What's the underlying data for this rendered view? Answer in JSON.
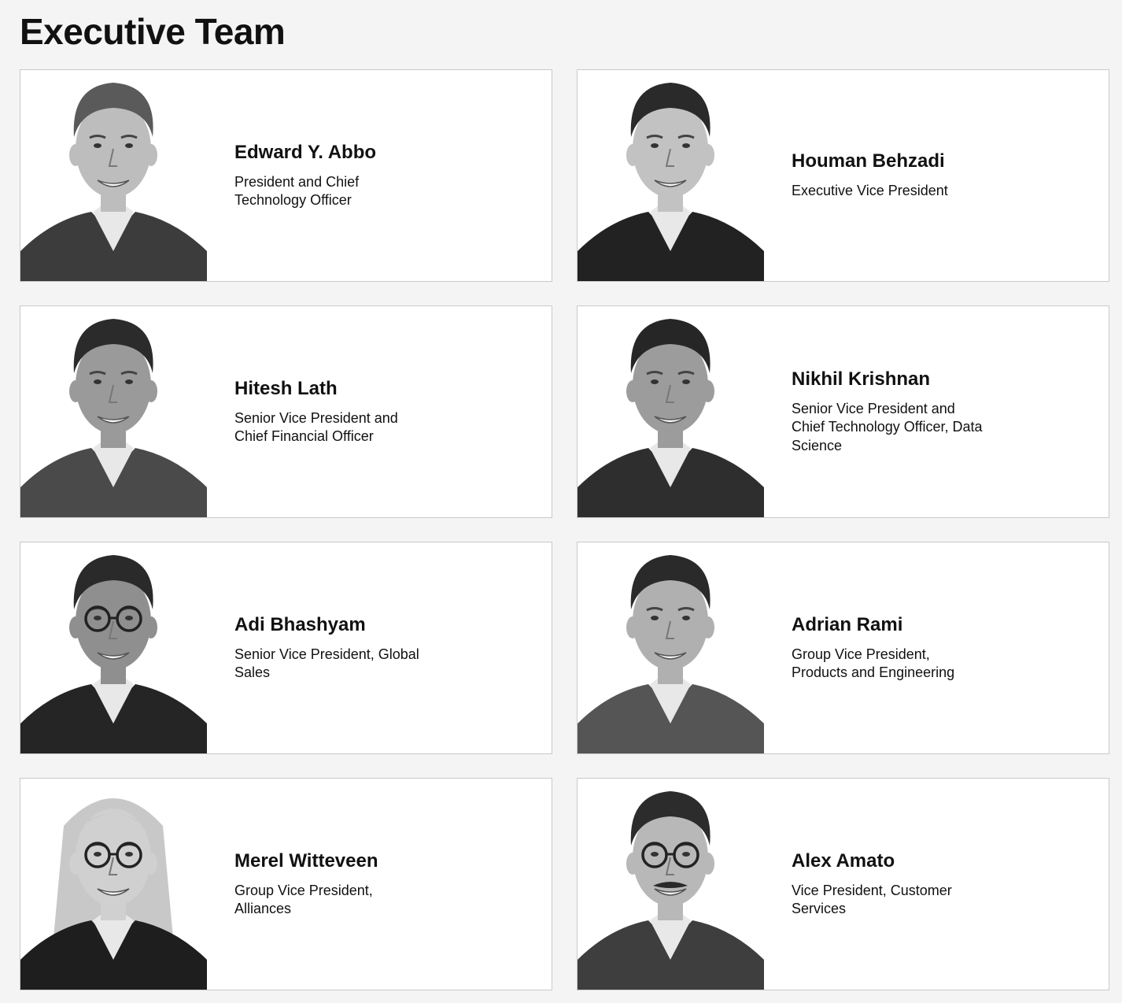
{
  "page": {
    "title": "Executive Team"
  },
  "team": [
    {
      "name": "Edward Y. Abbo",
      "role": "President and Chief Technology Officer",
      "role_lines": [
        "President and Chief",
        "Technology Officer"
      ],
      "hair": "#5a5a5a",
      "suit": "#3c3c3c",
      "skin": "#bdbdbd"
    },
    {
      "name": "Houman Behzadi",
      "role": "Executive Vice President",
      "role_lines": [
        "Executive Vice President"
      ],
      "hair": "#2a2a2a",
      "suit": "#222222",
      "skin": "#c2c2c2"
    },
    {
      "name": "Hitesh Lath",
      "role": "Senior Vice President and Chief Financial Officer",
      "role_lines": [
        "Senior Vice President and",
        "Chief Financial Officer"
      ],
      "hair": "#2b2b2b",
      "suit": "#4a4a4a",
      "skin": "#9a9a9a"
    },
    {
      "name": "Nikhil Krishnan",
      "role": "Senior Vice President and Chief Technology Officer, Data Science",
      "role_lines": [
        "Senior Vice President and",
        "Chief Technology Officer, Data",
        "Science"
      ],
      "hair": "#262626",
      "suit": "#2e2e2e",
      "skin": "#9c9c9c"
    },
    {
      "name": "Adi Bhashyam",
      "role": "Senior Vice President, Global Sales",
      "role_lines": [
        "Senior Vice President, Global",
        "Sales"
      ],
      "hair": "#2a2a2a",
      "suit": "#252525",
      "skin": "#8f8f8f"
    },
    {
      "name": "Adrian Rami",
      "role": "Group Vice President, Products and Engineering",
      "role_lines": [
        "Group Vice President,",
        "Products and Engineering"
      ],
      "hair": "#2a2a2a",
      "suit": "#555555",
      "skin": "#b0b0b0"
    },
    {
      "name": "Merel Witteveen",
      "role": "Group Vice President, Alliances",
      "role_lines": [
        "Group Vice President,",
        "Alliances"
      ],
      "hair": "#c8c8c8",
      "suit": "#1e1e1e",
      "skin": "#d0d0d0"
    },
    {
      "name": "Alex Amato",
      "role": "Vice President, Customer Services",
      "role_lines": [
        "Vice President, Customer",
        "Services"
      ],
      "hair": "#2c2c2c",
      "suit": "#3e3e3e",
      "skin": "#b8b8b8"
    }
  ]
}
